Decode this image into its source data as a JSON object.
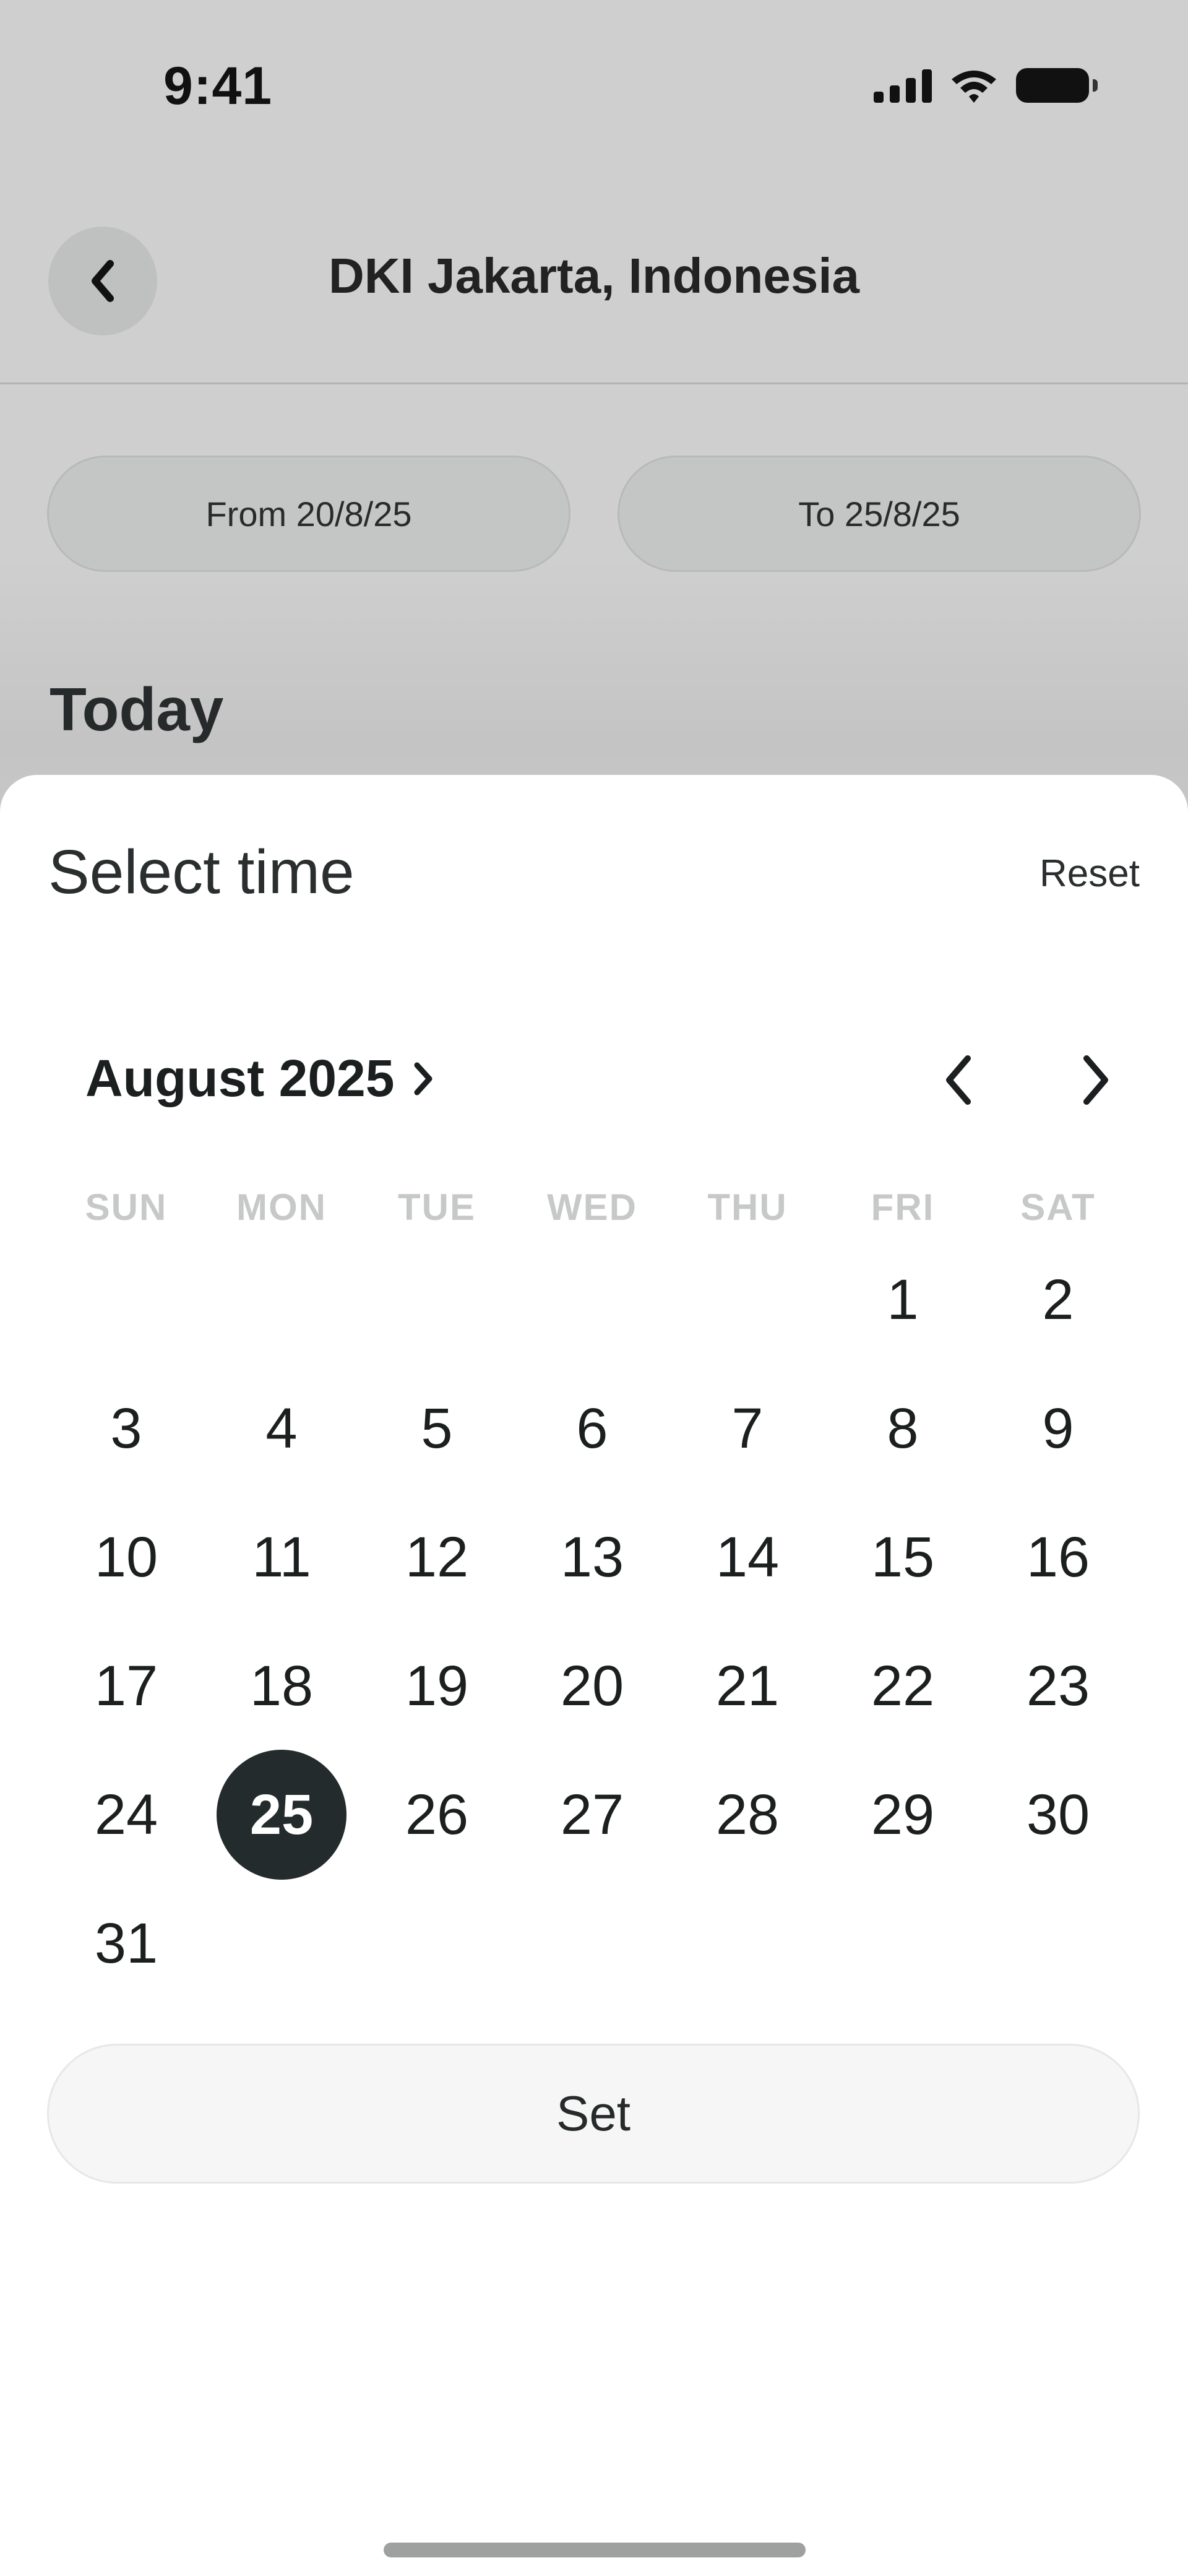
{
  "status_bar": {
    "time": "9:41",
    "icons": [
      "signal-icon",
      "wifi-icon",
      "battery-icon"
    ]
  },
  "header": {
    "title": "DKI Jakarta, Indonesia",
    "back_icon": "chevron-left-icon"
  },
  "filters": {
    "from_label": "From 20/8/25",
    "to_label": "To 25/8/25"
  },
  "section": {
    "today_label": "Today"
  },
  "sheet": {
    "title": "Select time",
    "reset_label": "Reset",
    "month_label": "August 2025",
    "weekdays": [
      "SUN",
      "MON",
      "TUE",
      "WED",
      "THU",
      "FRI",
      "SAT"
    ],
    "first_weekday_index": 5,
    "days_in_month": 31,
    "selected_day": 25,
    "set_label": "Set"
  },
  "colors": {
    "selected_day_bg": "#242b2c",
    "overlay": "#cfcfcf",
    "weekday_text": "#c7c9c9"
  }
}
